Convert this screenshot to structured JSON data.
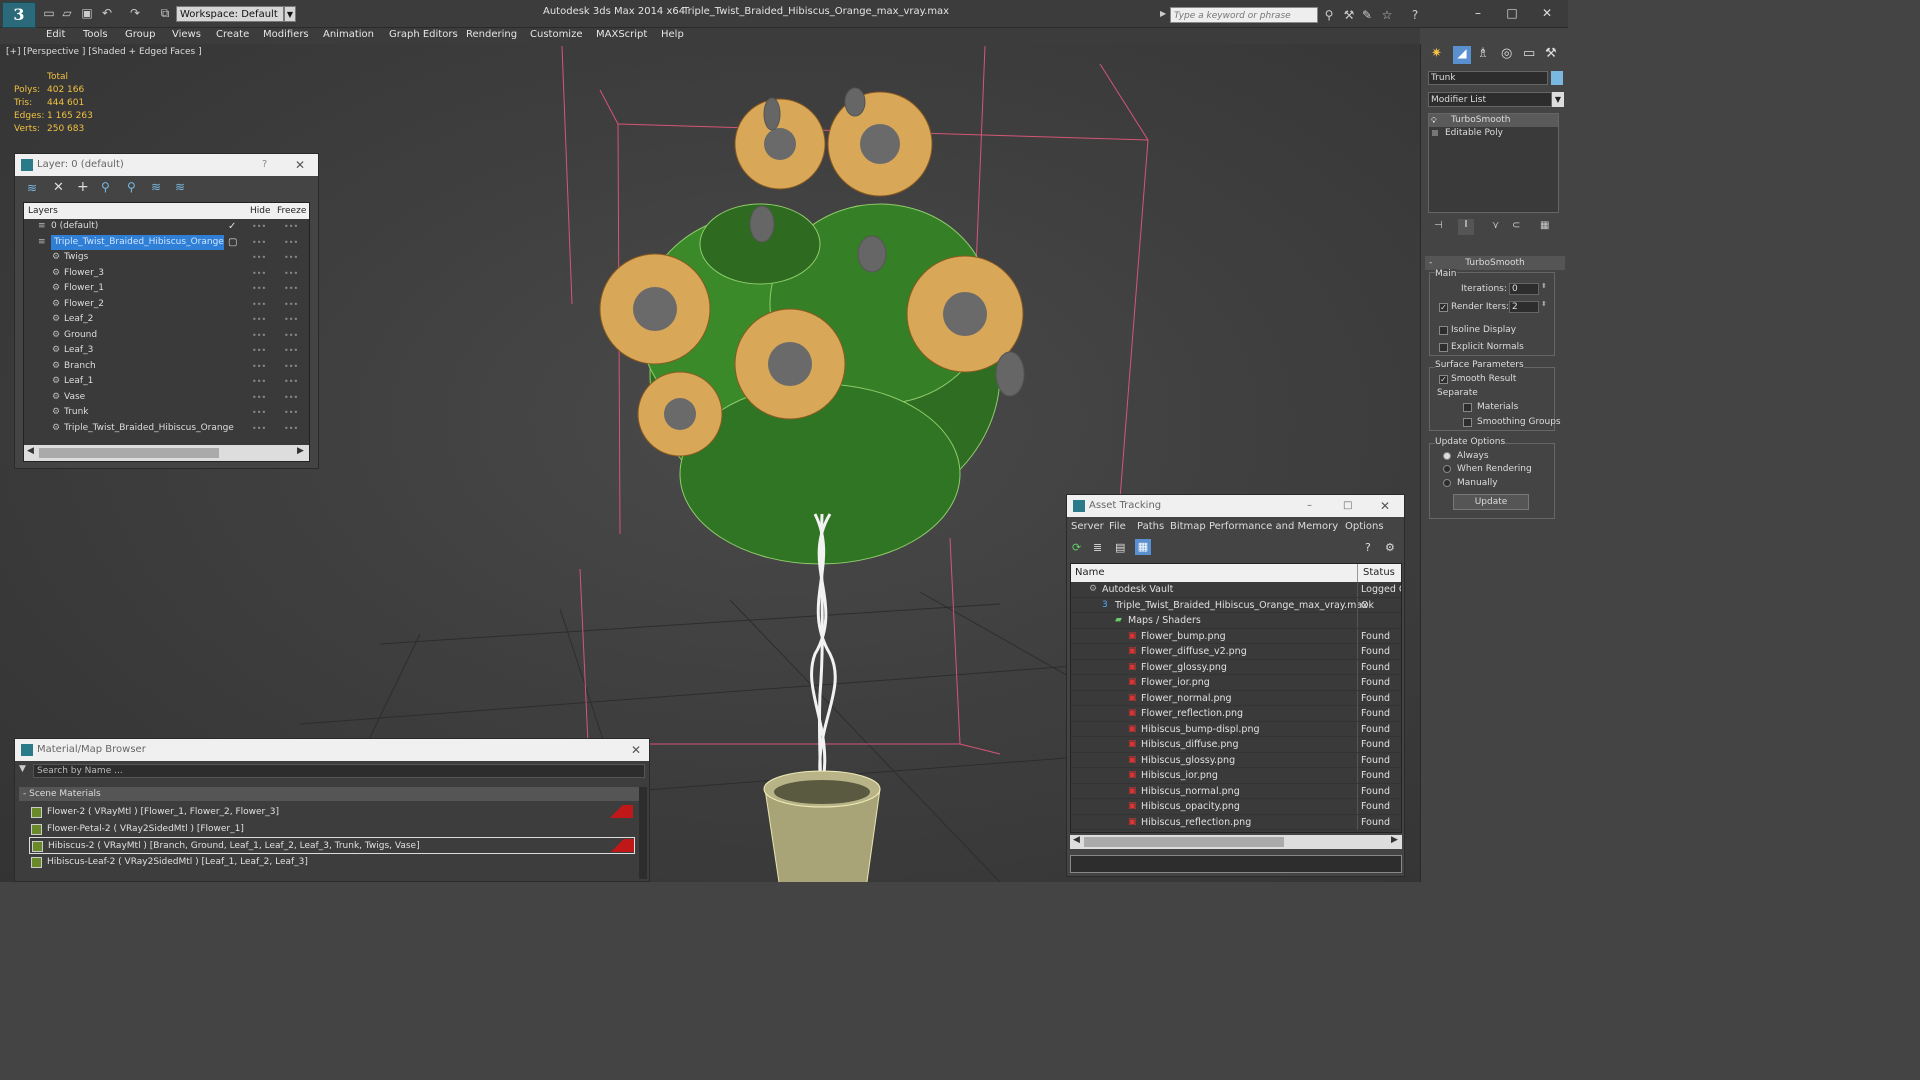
{
  "window": {
    "app_title": "Autodesk 3ds Max  2014 x64",
    "file_title": "Triple_Twist_Braided_Hibiscus_Orange_max_vray.max",
    "app_logo": "3",
    "workspace": "Workspace: Default",
    "search_placeholder": "Type a keyword or phrase",
    "accent_color": "#2a6a7a"
  },
  "menu": [
    "Edit",
    "Tools",
    "Group",
    "Views",
    "Create",
    "Modifiers",
    "Animation",
    "Graph Editors",
    "Rendering",
    "Customize",
    "MAXScript",
    "Help"
  ],
  "viewport": {
    "label": "[+] [Perspective ] [Shaded + Edged Faces ]",
    "stats": {
      "header": "Total",
      "rows": [
        {
          "label": "Polys:",
          "value": "402 166"
        },
        {
          "label": "Tris:",
          "value": "444 601"
        },
        {
          "label": "Edges:",
          "value": "1 165 263"
        },
        {
          "label": "Verts:",
          "value": "250 683"
        }
      ]
    }
  },
  "layer_panel": {
    "title": "Layer: 0 (default)",
    "help": "?",
    "columns": {
      "layers": "Layers",
      "hide": "Hide",
      "freeze": "Freeze"
    },
    "rows": [
      {
        "name": "0 (default)",
        "selected": false,
        "child": false
      },
      {
        "name": "Triple_Twist_Braided_Hibiscus_Orange",
        "selected": true,
        "child": false
      },
      {
        "name": "Twigs",
        "selected": false,
        "child": true
      },
      {
        "name": "Flower_3",
        "selected": false,
        "child": true
      },
      {
        "name": "Flower_1",
        "selected": false,
        "child": true
      },
      {
        "name": "Flower_2",
        "selected": false,
        "child": true
      },
      {
        "name": "Leaf_2",
        "selected": false,
        "child": true
      },
      {
        "name": "Ground",
        "selected": false,
        "child": true
      },
      {
        "name": "Leaf_3",
        "selected": false,
        "child": true
      },
      {
        "name": "Branch",
        "selected": false,
        "child": true
      },
      {
        "name": "Leaf_1",
        "selected": false,
        "child": true
      },
      {
        "name": "Vase",
        "selected": false,
        "child": true
      },
      {
        "name": "Trunk",
        "selected": false,
        "child": true
      },
      {
        "name": "Triple_Twist_Braided_Hibiscus_Orange",
        "selected": false,
        "child": true
      }
    ]
  },
  "material_browser": {
    "title": "Material/Map Browser",
    "search_placeholder": "Search by Name ...",
    "group": "- Scene Materials",
    "items": [
      {
        "label": "Flower-2  ( VRayMtl )  [Flower_1, Flower_2, Flower_3]",
        "flag": true,
        "selected": false
      },
      {
        "label": "Flower-Petal-2  ( VRay2SidedMtl )  [Flower_1]",
        "flag": false,
        "selected": false
      },
      {
        "label": "Hibiscus-2  ( VRayMtl )  [Branch, Ground, Leaf_1, Leaf_2, Leaf_3, Trunk, Twigs, Vase]",
        "flag": true,
        "selected": true
      },
      {
        "label": "Hibiscus-Leaf-2  ( VRay2SidedMtl )  [Leaf_1, Leaf_2, Leaf_3]",
        "flag": false,
        "selected": false
      }
    ]
  },
  "asset_tracking": {
    "title": "Asset Tracking",
    "menu": [
      "Server",
      "File",
      "Paths",
      "Bitmap Performance and Memory",
      "Options"
    ],
    "columns": {
      "name": "Name",
      "status": "Status"
    },
    "rows": [
      {
        "name": "Autodesk Vault",
        "status": "Logged O",
        "level": 0,
        "icon": "vault"
      },
      {
        "name": "Triple_Twist_Braided_Hibiscus_Orange_max_vray.max",
        "status": "Ok",
        "level": 1,
        "icon": "max"
      },
      {
        "name": "Maps / Shaders",
        "status": "",
        "level": 2,
        "icon": "folder"
      },
      {
        "name": "Flower_bump.png",
        "status": "Found",
        "level": 3,
        "icon": "png"
      },
      {
        "name": "Flower_diffuse_v2.png",
        "status": "Found",
        "level": 3,
        "icon": "png"
      },
      {
        "name": "Flower_glossy.png",
        "status": "Found",
        "level": 3,
        "icon": "png"
      },
      {
        "name": "Flower_ior.png",
        "status": "Found",
        "level": 3,
        "icon": "png"
      },
      {
        "name": "Flower_normal.png",
        "status": "Found",
        "level": 3,
        "icon": "png"
      },
      {
        "name": "Flower_reflection.png",
        "status": "Found",
        "level": 3,
        "icon": "png"
      },
      {
        "name": "Hibiscus_bump-displ.png",
        "status": "Found",
        "level": 3,
        "icon": "png"
      },
      {
        "name": "Hibiscus_diffuse.png",
        "status": "Found",
        "level": 3,
        "icon": "png"
      },
      {
        "name": "Hibiscus_glossy.png",
        "status": "Found",
        "level": 3,
        "icon": "png"
      },
      {
        "name": "Hibiscus_ior.png",
        "status": "Found",
        "level": 3,
        "icon": "png"
      },
      {
        "name": "Hibiscus_normal.png",
        "status": "Found",
        "level": 3,
        "icon": "png"
      },
      {
        "name": "Hibiscus_opacity.png",
        "status": "Found",
        "level": 3,
        "icon": "png"
      },
      {
        "name": "Hibiscus_reflection.png",
        "status": "Found",
        "level": 3,
        "icon": "png"
      }
    ]
  },
  "command_panel": {
    "object_name": "Trunk",
    "modifier_list": "Modifier List",
    "stack": [
      "TurboSmooth",
      "Editable Poly"
    ],
    "rollout": "TurboSmooth",
    "main": "Main",
    "iterations_label": "Iterations:",
    "iterations": "0",
    "render_iters_label": "Render Iters:",
    "render_iters": "2",
    "isoline": "Isoline Display",
    "explicit": "Explicit Normals",
    "surface": "Surface Parameters",
    "smooth": "Smooth Result",
    "separate": "Separate",
    "materials": "Materials",
    "smoothing": "Smoothing Groups",
    "update_options": "Update Options",
    "always": "Always",
    "when_rendering": "When Rendering",
    "manually": "Manually",
    "update": "Update"
  }
}
